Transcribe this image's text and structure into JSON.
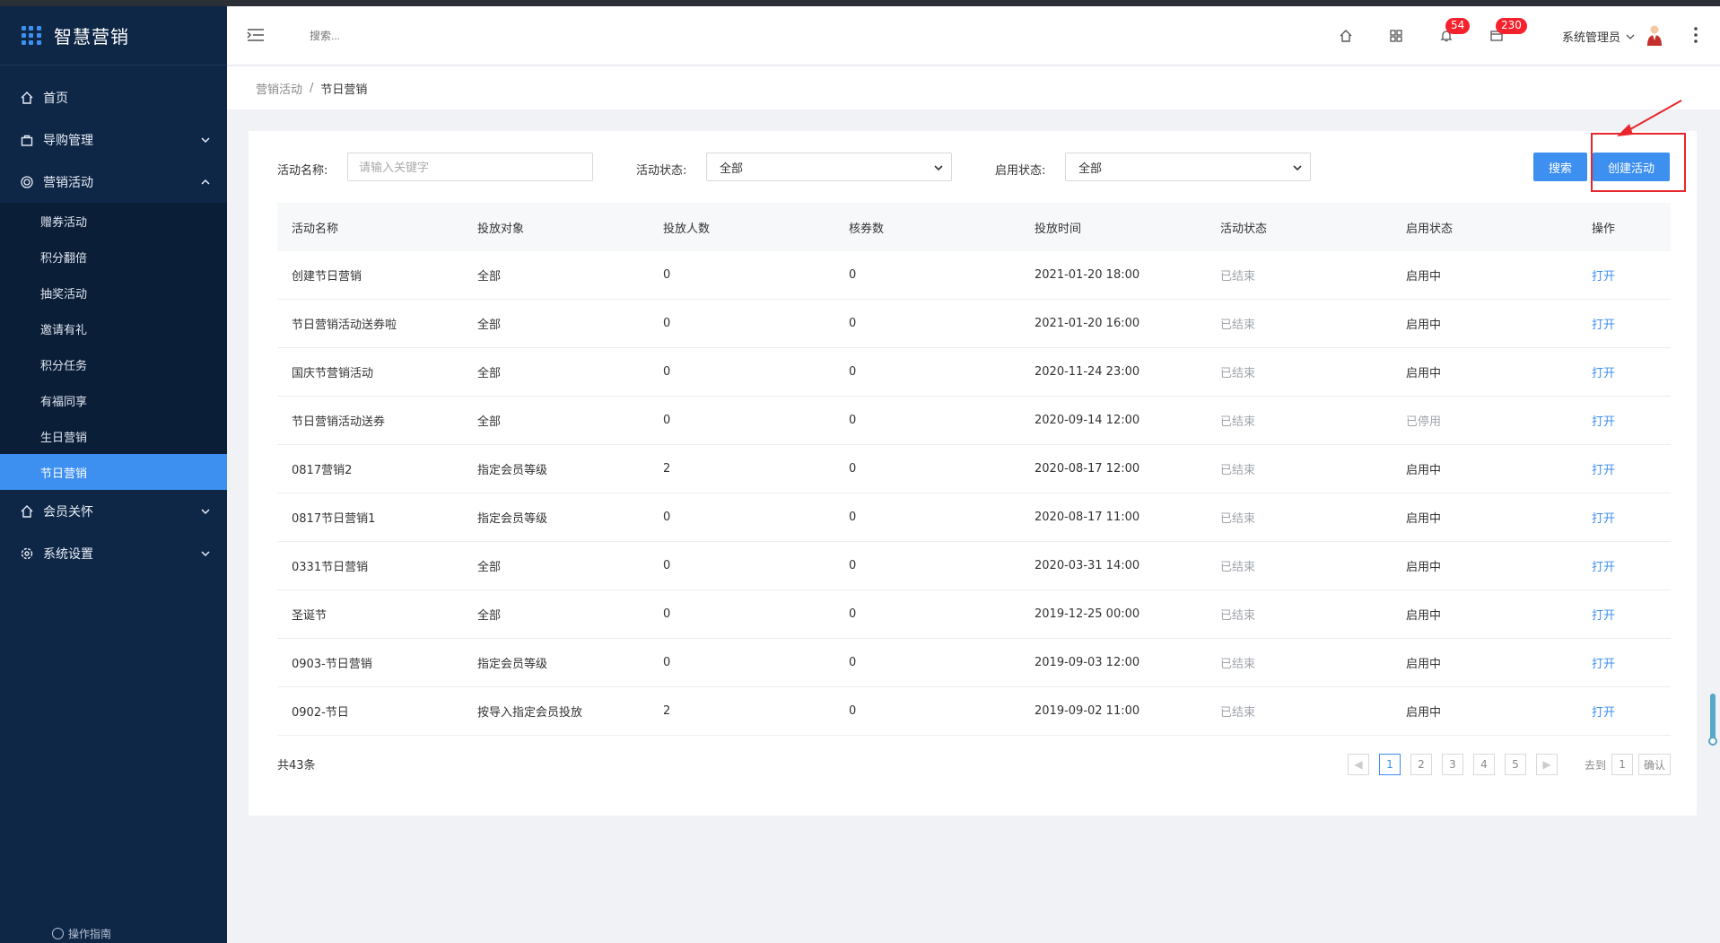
{
  "app": {
    "title": "智慧营销"
  },
  "sidebar": {
    "items": [
      {
        "label": "首页",
        "icon": "home-icon"
      },
      {
        "label": "导购管理",
        "icon": "bag-icon"
      },
      {
        "label": "营销活动",
        "icon": "target-icon"
      },
      {
        "label": "会员关怀",
        "icon": "home-icon"
      },
      {
        "label": "系统设置",
        "icon": "gear-icon"
      }
    ],
    "subitems": [
      {
        "label": "赠券活动"
      },
      {
        "label": "积分翻倍"
      },
      {
        "label": "抽奖活动"
      },
      {
        "label": "邀请有礼"
      },
      {
        "label": "积分任务"
      },
      {
        "label": "有福同享"
      },
      {
        "label": "生日营销"
      },
      {
        "label": "节日营销"
      }
    ],
    "guide": "操作指南"
  },
  "header": {
    "search_placeholder": "搜索...",
    "badge_bell": "54",
    "badge_msg": "230",
    "user": "系统管理员"
  },
  "breadcrumb": {
    "parent": "营销活动",
    "sep": "/",
    "current": "节日营销"
  },
  "filter": {
    "name_label": "活动名称:",
    "name_placeholder": "请输入关键字",
    "status_label": "活动状态:",
    "status_value": "全部",
    "enable_label": "启用状态:",
    "enable_value": "全部",
    "search_button": "搜索",
    "create_button": "创建活动"
  },
  "table": {
    "headers": [
      "活动名称",
      "投放对象",
      "投放人数",
      "核券数",
      "投放时间",
      "活动状态",
      "启用状态",
      "操作"
    ],
    "rows": [
      [
        "创建节日营销",
        "全部",
        "0",
        "0",
        "2021-01-20 18:00",
        "已结束",
        "启用中",
        "打开"
      ],
      [
        "节日营销活动送券啦",
        "全部",
        "0",
        "0",
        "2021-01-20 16:00",
        "已结束",
        "启用中",
        "打开"
      ],
      [
        "国庆节营销活动",
        "全部",
        "0",
        "0",
        "2020-11-24 23:00",
        "已结束",
        "启用中",
        "打开"
      ],
      [
        "节日营销活动送券",
        "全部",
        "0",
        "0",
        "2020-09-14 12:00",
        "已结束",
        "已停用",
        "打开"
      ],
      [
        "0817营销2",
        "指定会员等级",
        "2",
        "0",
        "2020-08-17 12:00",
        "已结束",
        "启用中",
        "打开"
      ],
      [
        "0817节日营销1",
        "指定会员等级",
        "0",
        "0",
        "2020-08-17 11:00",
        "已结束",
        "启用中",
        "打开"
      ],
      [
        "0331节日营销",
        "全部",
        "0",
        "0",
        "2020-03-31 14:00",
        "已结束",
        "启用中",
        "打开"
      ],
      [
        "圣诞节",
        "全部",
        "0",
        "0",
        "2019-12-25 00:00",
        "已结束",
        "启用中",
        "打开"
      ],
      [
        "0903-节日营销",
        "指定会员等级",
        "0",
        "0",
        "2019-09-03 12:00",
        "已结束",
        "启用中",
        "打开"
      ],
      [
        "0902-节日",
        "按导入指定会员投放",
        "2",
        "0",
        "2019-09-02 11:00",
        "已结束",
        "启用中",
        "打开"
      ]
    ]
  },
  "footer": {
    "total": "共43条",
    "pages": [
      "1",
      "2",
      "3",
      "4",
      "5"
    ],
    "goto_label": "去到",
    "goto_value": "1",
    "confirm": "确认"
  },
  "colors": {
    "accent": "#3d8ff0",
    "sidebar": "#0f2747",
    "highlight": "#e8262b"
  }
}
